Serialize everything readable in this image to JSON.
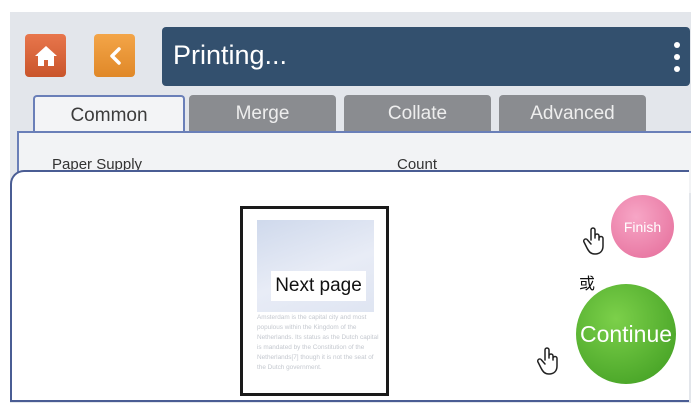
{
  "header": {
    "title": "Printing...",
    "colors": {
      "title_bar": "#33506e",
      "home": "#d9643a",
      "back": "#ec9a3a"
    }
  },
  "tabs": [
    {
      "label": "Common",
      "active": true
    },
    {
      "label": "Merge",
      "active": false
    },
    {
      "label": "Collate",
      "active": false
    },
    {
      "label": "Advanced",
      "active": false
    }
  ],
  "panel": {
    "col1": "Paper Supply",
    "col2": "Count"
  },
  "preview": {
    "label": "Next page",
    "body": "Amsterdam is the capital city and most populous within the Kingdom of the Netherlands. Its status as the Dutch capital is mandated by the Constitution of the Netherlands[7] though it is not the seat of the Dutch government."
  },
  "actions": {
    "finish": "Finish",
    "or": "或",
    "continue": "Continue",
    "colors": {
      "finish": "#ea7aa6",
      "continue": "#4fb02a"
    }
  },
  "icons": {
    "home": "home-icon",
    "back": "chevron-left-icon",
    "menu": "more-vert-icon",
    "hand": "hand-pointer-icon"
  }
}
